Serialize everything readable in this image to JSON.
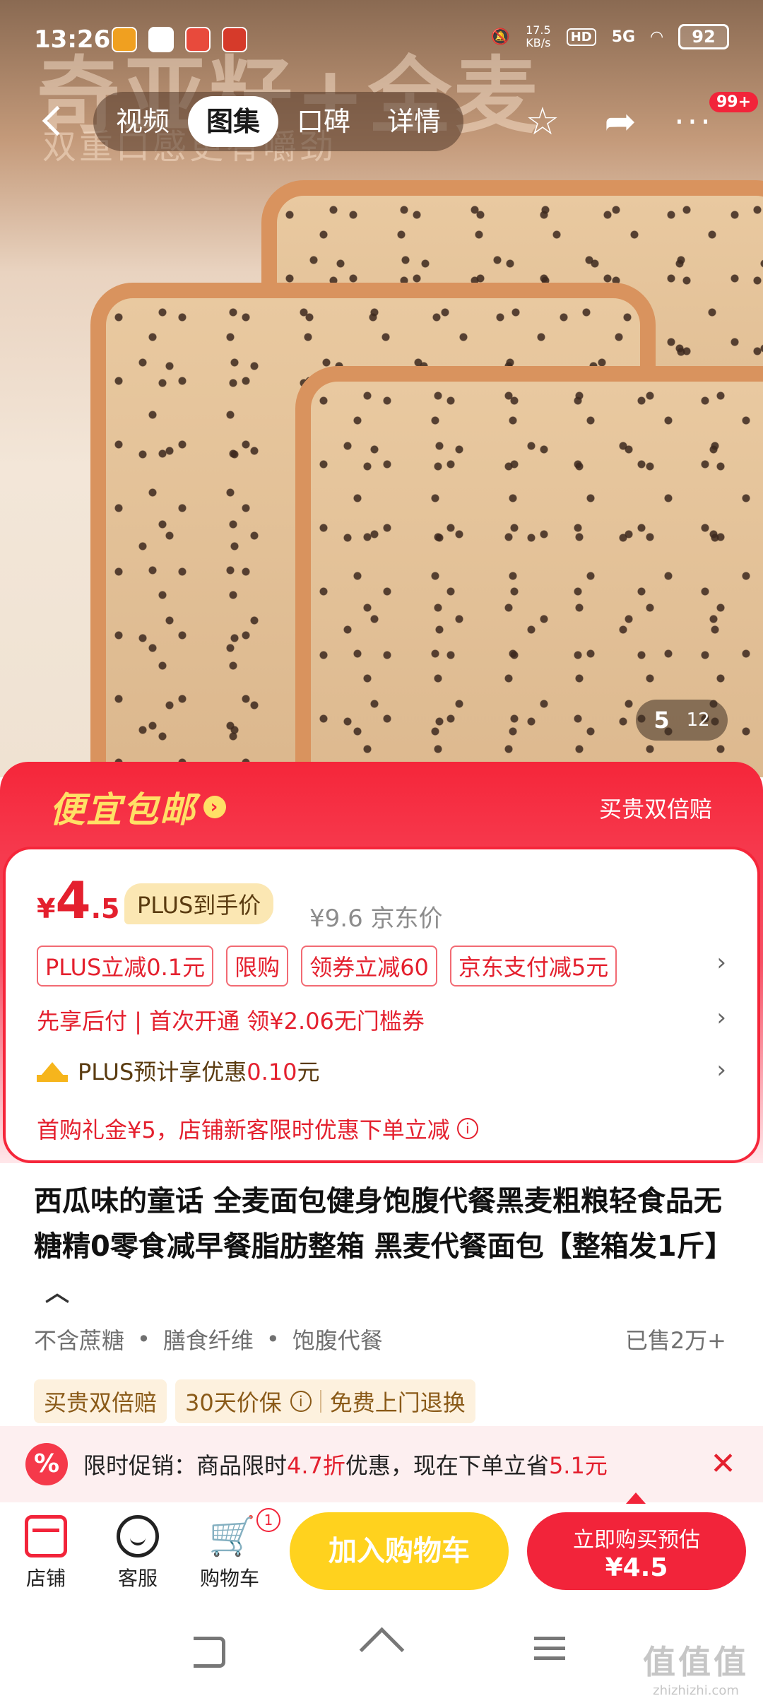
{
  "status_bar": {
    "time": "13:26",
    "net_speed_value": "17.5",
    "net_speed_unit": "KB/s",
    "hd": "HD",
    "network": "5G",
    "battery": "92"
  },
  "hero": {
    "bg_text": "奇亚籽+全麦",
    "bg_subtext": "双重口感更有嚼劲",
    "image_index": "5",
    "image_total": "12"
  },
  "top_nav": {
    "tabs": [
      {
        "label": "视频"
      },
      {
        "label": "图集"
      },
      {
        "label": "口碑"
      },
      {
        "label": "详情"
      }
    ],
    "active_tab": "图集",
    "message_badge": "99+",
    "icons": [
      "back-icon",
      "star-icon",
      "share-icon",
      "more-icon"
    ]
  },
  "promo_header": {
    "title": "便宜包邮",
    "right_text": "买贵双倍赔"
  },
  "price": {
    "currency": "¥",
    "int": "4",
    "dec": ".5",
    "plus_tag": "PLUS到手价",
    "original": "¥9.6 京东价"
  },
  "coupons": [
    {
      "label": "PLUS立减0.1元"
    },
    {
      "label": "限购"
    },
    {
      "label": "领券立减60"
    },
    {
      "label": "京东支付减5元"
    }
  ],
  "credit_line": "先享后付 | 首次开通 领¥2.06无门槛券",
  "plus_line": {
    "prefix": "PLUS预计享优惠",
    "amount": "0.10",
    "suffix": "元"
  },
  "gift_line": "首购礼金¥5，店铺新客限时优惠下单立减",
  "product": {
    "title": "西瓜味的童话 全麦面包健身饱腹代餐黑麦粗粮轻食品无糖精0零食减早餐脂肪整箱 黑麦代餐面包【整箱发1斤】",
    "features": [
      "不含蔗糖",
      "膳食纤维",
      "饱腹代餐"
    ],
    "sold": "已售2万+"
  },
  "guarantees": {
    "first": "买贵双倍赔",
    "second": "30天价保",
    "third": "免费上门退换"
  },
  "limited_promo": {
    "prefix": "限时促销：商品限时",
    "discount": "4.7折",
    "middle": "优惠，现在下单立省",
    "saving": "5.1元"
  },
  "action_bar": {
    "store": "店铺",
    "service": "客服",
    "cart": "购物车",
    "cart_count": "1",
    "add_to_cart": "加入购物车",
    "buy_line1": "立即购买预估",
    "buy_line2": "¥4.5"
  },
  "watermark": {
    "line1": "值值值",
    "line2": "zhizhizhi.com"
  },
  "colors": {
    "brand_red": "#f2243a",
    "price_red": "#e4202e",
    "cart_yellow": "#ffd21e",
    "promo_yellow": "#ffe066"
  }
}
